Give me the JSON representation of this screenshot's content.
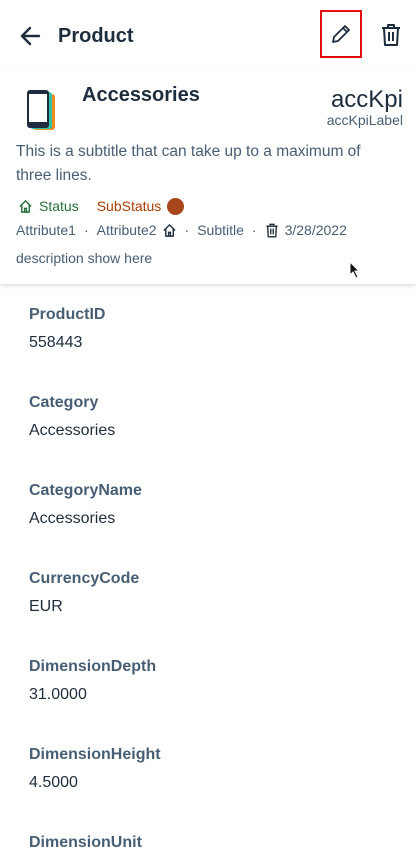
{
  "appbar": {
    "title": "Product"
  },
  "header": {
    "name": "Accessories",
    "kpi": "accKpi",
    "kpi_label": "accKpiLabel",
    "subtitle": "This is a subtitle that can take up to a maximum of three lines.",
    "status": "Status",
    "substatus": "SubStatus",
    "attributes": {
      "attr1": "Attribute1",
      "attr2": "Attribute2",
      "subtitle": "Subtitle",
      "date": "3/28/2022",
      "sep": "·"
    },
    "description": "description show here",
    "colors": {
      "status": "#256f3a",
      "substatus": "#aa3d00",
      "substatus_dot": "#a8461c",
      "edit_highlight": "#e01010"
    }
  },
  "fields": [
    {
      "label": "ProductID",
      "value": "558443"
    },
    {
      "label": "Category",
      "value": "Accessories"
    },
    {
      "label": "CategoryName",
      "value": "Accessories"
    },
    {
      "label": "CurrencyCode",
      "value": "EUR"
    },
    {
      "label": "DimensionDepth",
      "value": "31.0000"
    },
    {
      "label": "DimensionHeight",
      "value": "4.5000"
    },
    {
      "label": "DimensionUnit",
      "value": ""
    }
  ],
  "icons": [
    "back-arrow-icon",
    "pencil-icon",
    "trash-icon",
    "home-icon",
    "mouse-cursor-icon",
    "phone-icon"
  ]
}
